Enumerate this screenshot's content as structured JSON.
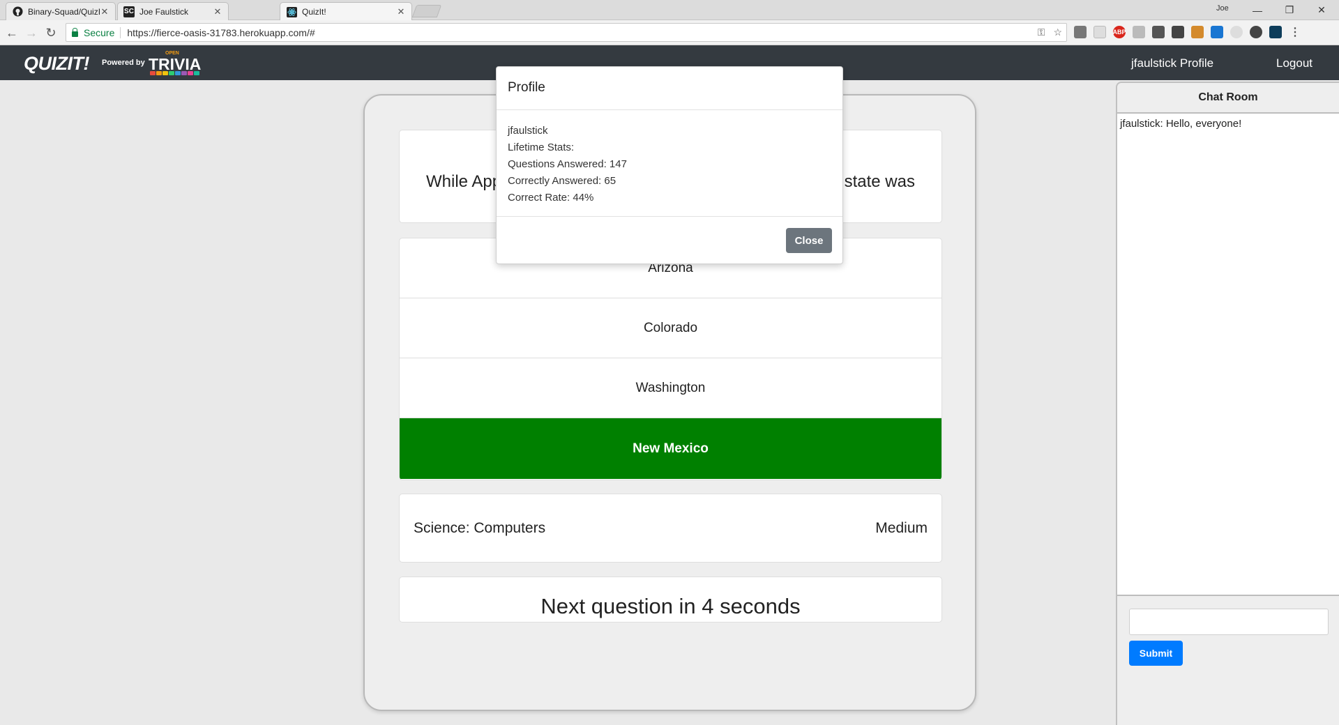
{
  "browser": {
    "tabs": [
      {
        "title": "Binary-Squad/QuizIt: Qu",
        "icon": "github-icon"
      },
      {
        "title": "Joe Faulstick",
        "icon": "sc-icon"
      },
      {
        "title": "QuizIt!",
        "icon": "react-icon"
      }
    ],
    "window_user": "Joe",
    "secure_label": "Secure",
    "url": "https://fierce-oasis-31783.herokuapp.com/#"
  },
  "nav": {
    "logo": "QUIZIT!",
    "powered_by": "Powered by",
    "trivia_top": "OPEN",
    "trivia_word": "TRIVIA",
    "profile_link": "jfaulstick Profile",
    "logout_link": "Logout"
  },
  "quiz": {
    "question_left": "While App",
    "question_right": "state was",
    "answers": [
      "Arizona",
      "Colorado",
      "Washington",
      "New Mexico"
    ],
    "correct_answer_color": "#008000",
    "category": "Science: Computers",
    "difficulty": "Medium",
    "timer_text": "Next question in 4 seconds"
  },
  "chat": {
    "title": "Chat Room",
    "messages": [
      "jfaulstick: Hello, everyone!"
    ],
    "input_value": "",
    "submit_label": "Submit"
  },
  "modal": {
    "title": "Profile",
    "username": "jfaulstick",
    "lifetime_label": "Lifetime Stats:",
    "questions_answered": "Questions Answered: 147",
    "correctly_answered": "Correctly Answered: 65",
    "correct_rate": "Correct Rate: 44%",
    "close_label": "Close"
  },
  "colors": {
    "nav_bg": "#343a40",
    "submit_button": "#007bff",
    "close_button": "#6c757d"
  }
}
